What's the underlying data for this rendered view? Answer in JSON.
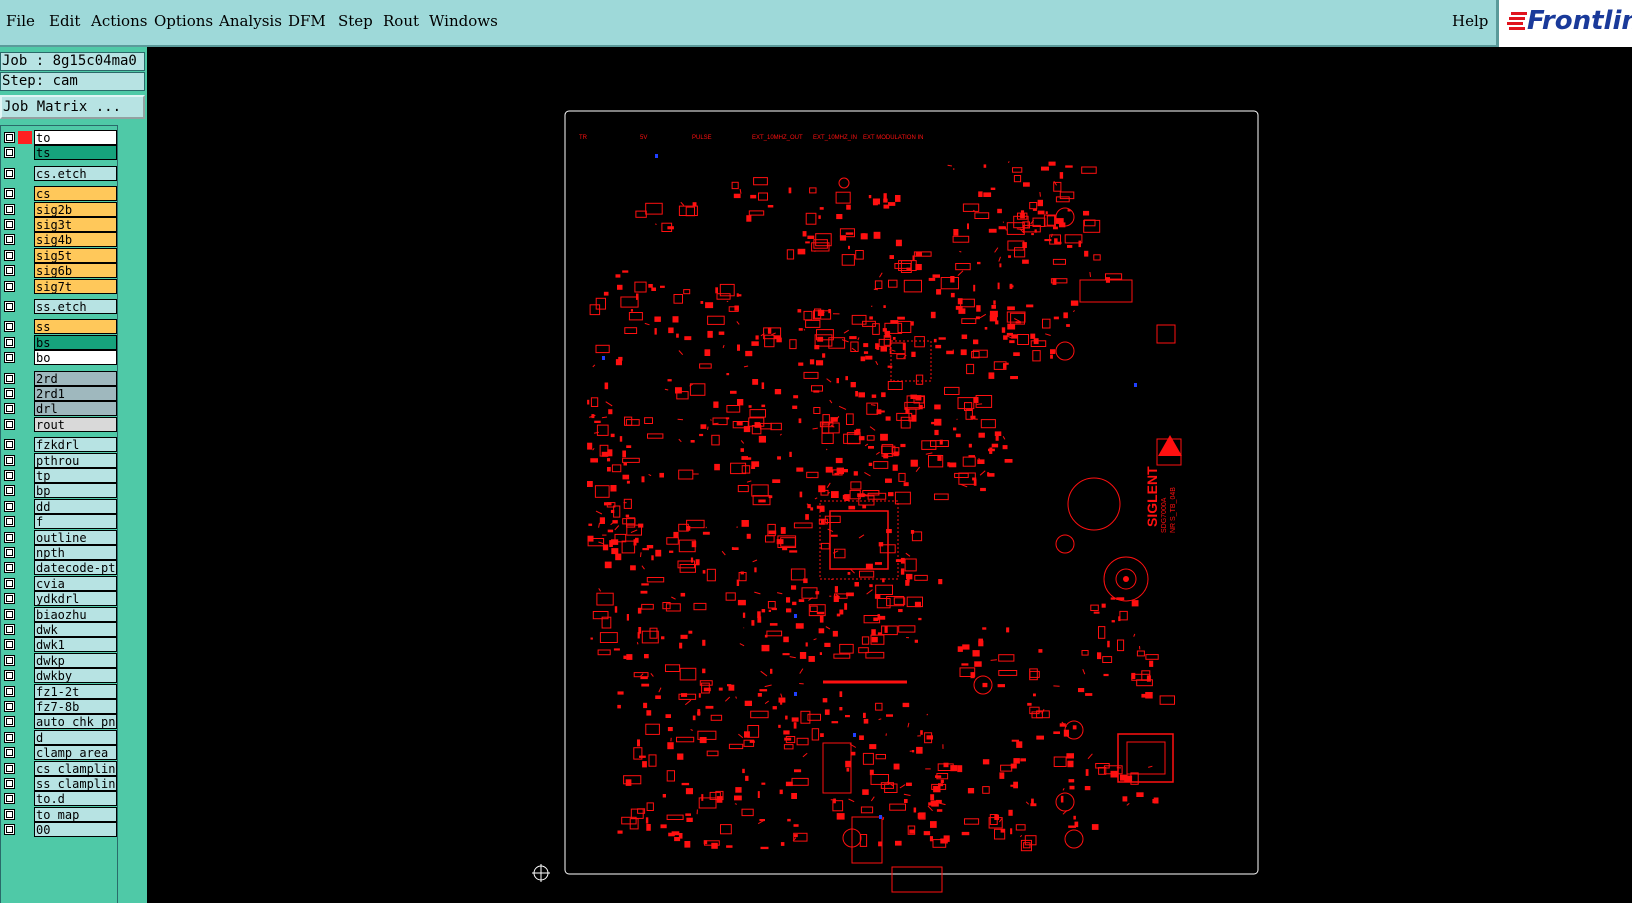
{
  "menu": {
    "items": [
      "File",
      "Edit",
      "Actions",
      "Options",
      "Analysis",
      "DFM",
      "Step",
      "Rout",
      "Windows"
    ],
    "help": "Help"
  },
  "logo": {
    "text": "Frontline"
  },
  "job": {
    "label": "Job : 8g15c04ma0"
  },
  "step": {
    "label": "Step: cam"
  },
  "job_matrix": {
    "label": "Job Matrix ..."
  },
  "layers": [
    {
      "name": "to",
      "color": "#ffffff",
      "swatch": "#ff2020"
    },
    {
      "name": "ts",
      "color": "#16a37c",
      "swatch": ""
    },
    {
      "name": "cs.etch",
      "color": "#b7e3e3",
      "swatch": "",
      "gap": true
    },
    {
      "name": "cs",
      "color": "#ffc85a",
      "swatch": "",
      "gap": true
    },
    {
      "name": "sig2b",
      "color": "#ffc85a",
      "swatch": ""
    },
    {
      "name": "sig3t",
      "color": "#ffc85a",
      "swatch": ""
    },
    {
      "name": "sig4b",
      "color": "#ffc85a",
      "swatch": ""
    },
    {
      "name": "sig5t",
      "color": "#ffc85a",
      "swatch": ""
    },
    {
      "name": "sig6b",
      "color": "#ffc85a",
      "swatch": ""
    },
    {
      "name": "sig7t",
      "color": "#ffc85a",
      "swatch": ""
    },
    {
      "name": "ss.etch",
      "color": "#b7e3e3",
      "swatch": "",
      "gap": true
    },
    {
      "name": "ss",
      "color": "#ffc85a",
      "swatch": "",
      "gap": true
    },
    {
      "name": "bs",
      "color": "#16a37c",
      "swatch": ""
    },
    {
      "name": "bo",
      "color": "#ffffff",
      "swatch": ""
    },
    {
      "name": "2rd",
      "color": "#9fb8be",
      "swatch": "",
      "gap": true
    },
    {
      "name": "2rd1",
      "color": "#9fb8be",
      "swatch": ""
    },
    {
      "name": "drl",
      "color": "#9fb8be",
      "swatch": ""
    },
    {
      "name": "rout",
      "color": "#d9d9d9",
      "swatch": ""
    },
    {
      "name": "fzkdrl",
      "color": "#b7e3e3",
      "swatch": "",
      "gap": true
    },
    {
      "name": "pthrou",
      "color": "#b7e3e3",
      "swatch": ""
    },
    {
      "name": "tp",
      "color": "#b7e3e3",
      "swatch": ""
    },
    {
      "name": "bp",
      "color": "#b7e3e3",
      "swatch": ""
    },
    {
      "name": "dd",
      "color": "#b7e3e3",
      "swatch": ""
    },
    {
      "name": "f",
      "color": "#b7e3e3",
      "swatch": ""
    },
    {
      "name": "outline",
      "color": "#b7e3e3",
      "swatch": ""
    },
    {
      "name": "npth",
      "color": "#b7e3e3",
      "swatch": ""
    },
    {
      "name": "datecode-ptc",
      "color": "#b7e3e3",
      "swatch": ""
    },
    {
      "name": "cvia",
      "color": "#b7e3e3",
      "swatch": ""
    },
    {
      "name": "ydkdrl",
      "color": "#b7e3e3",
      "swatch": ""
    },
    {
      "name": "biaozhu",
      "color": "#b7e3e3",
      "swatch": ""
    },
    {
      "name": "dwk",
      "color": "#b7e3e3",
      "swatch": ""
    },
    {
      "name": "dwk1",
      "color": "#b7e3e3",
      "swatch": ""
    },
    {
      "name": "dwkp",
      "color": "#b7e3e3",
      "swatch": ""
    },
    {
      "name": "dwkby",
      "color": "#b7e3e3",
      "swatch": ""
    },
    {
      "name": "fz1-2t",
      "color": "#b7e3e3",
      "swatch": ""
    },
    {
      "name": "fz7-8b",
      "color": "#b7e3e3",
      "swatch": ""
    },
    {
      "name": "auto_chk_pnl",
      "color": "#b7e3e3",
      "swatch": ""
    },
    {
      "name": "d",
      "color": "#b7e3e3",
      "swatch": ""
    },
    {
      "name": "clamp_area",
      "color": "#b7e3e3",
      "swatch": ""
    },
    {
      "name": "cs_clampline",
      "color": "#b7e3e3",
      "swatch": ""
    },
    {
      "name": "ss_clampline",
      "color": "#b7e3e3",
      "swatch": ""
    },
    {
      "name": "to.d",
      "color": "#b7e3e3",
      "swatch": ""
    },
    {
      "name": "to_map",
      "color": "#b7e3e3",
      "swatch": ""
    },
    {
      "name": "00",
      "color": "#b7e3e3",
      "swatch": ""
    }
  ],
  "board": {
    "top_labels": [
      "TR",
      "5V",
      "PULSE",
      "EXT_10MHZ_OUT",
      "EXT_10MHZ_IN",
      "EXT MODULATION IN"
    ],
    "brand": "SIGLENT",
    "code_lines": [
      "SDG7000A",
      "NR S_TB_04B"
    ]
  },
  "colors": {
    "trace": "#ff1010",
    "accent_blue": "#2040ff",
    "outline": "#ffffff"
  }
}
